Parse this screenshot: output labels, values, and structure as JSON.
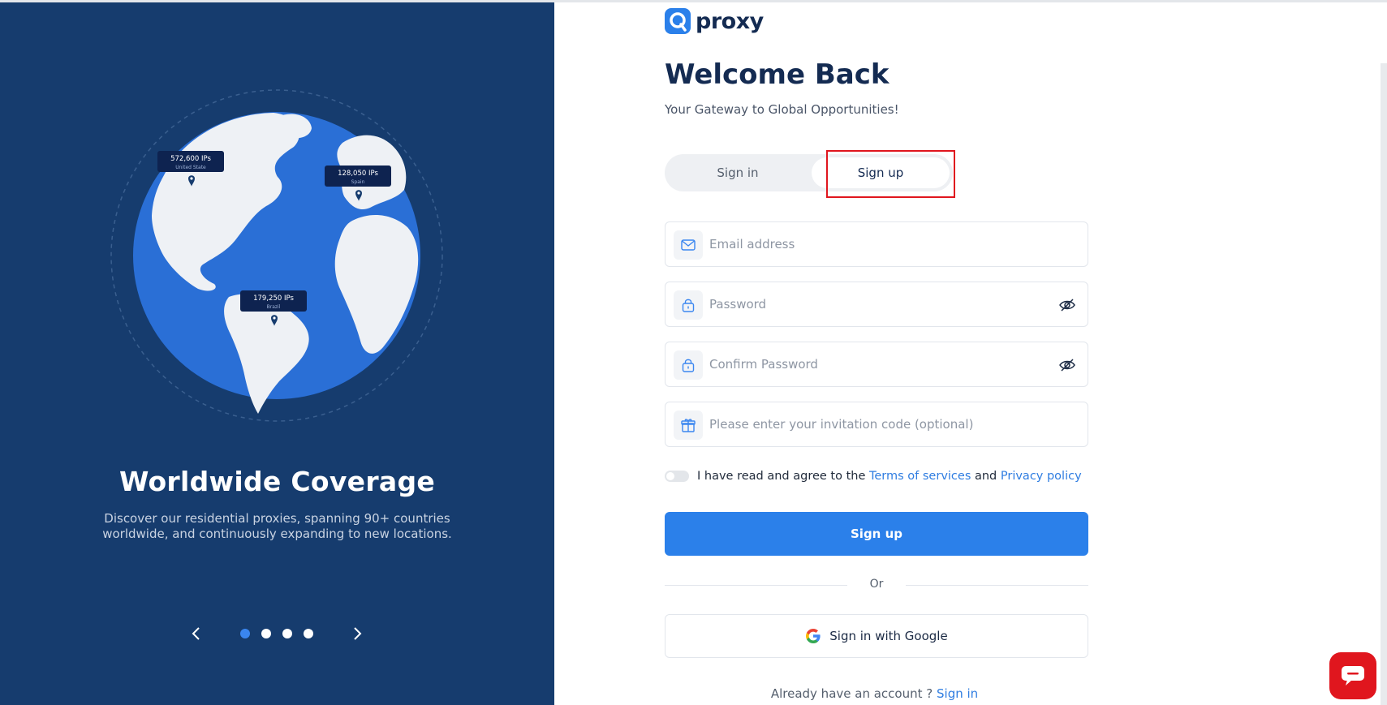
{
  "brand": {
    "name": "proxy"
  },
  "hero": {
    "title": "Worldwide Coverage",
    "description": "Discover our residential proxies, spanning 90+ countries worldwide, and continuously expanding to new locations.",
    "markers": [
      {
        "ips": "572,600 IPs",
        "country": "United State"
      },
      {
        "ips": "128,050 IPs",
        "country": "Spain"
      },
      {
        "ips": "179,250 IPs",
        "country": "Brazil"
      }
    ],
    "carousel": {
      "active_index": 0,
      "total": 4
    }
  },
  "form": {
    "heading": "Welcome Back",
    "subheading": "Your Gateway to Global Opportunities!",
    "tabs": {
      "signin": "Sign in",
      "signup": "Sign up",
      "selected": "signup"
    },
    "fields": {
      "email": {
        "placeholder": "Email address",
        "value": ""
      },
      "password": {
        "placeholder": "Password",
        "value": ""
      },
      "confirm_password": {
        "placeholder": "Confirm Password",
        "value": ""
      },
      "invitation": {
        "placeholder": "Please enter your invitation code (optional)",
        "value": ""
      }
    },
    "agree": {
      "prefix": "I have read and agree to the",
      "terms": "Terms of services",
      "and": "and",
      "privacy": "Privacy policy",
      "checked": false
    },
    "submit_label": "Sign up",
    "or_label": "Or",
    "google_label": "Sign in with Google",
    "footer": {
      "text": "Already have an account ?",
      "link": "Sign in"
    }
  },
  "colors": {
    "left_panel_bg": "#163c6e",
    "globe_ocean": "#2a6fd6",
    "accent": "#2b80ea",
    "highlight": "#e0161e",
    "chat_button": "#e0161e"
  },
  "icons": {
    "email": "mail-icon",
    "password": "lock-icon",
    "confirm_password": "lock-icon",
    "invitation": "gift-icon",
    "eye": "eye-off-icon",
    "google": "google-icon",
    "chat": "chat-icon"
  }
}
